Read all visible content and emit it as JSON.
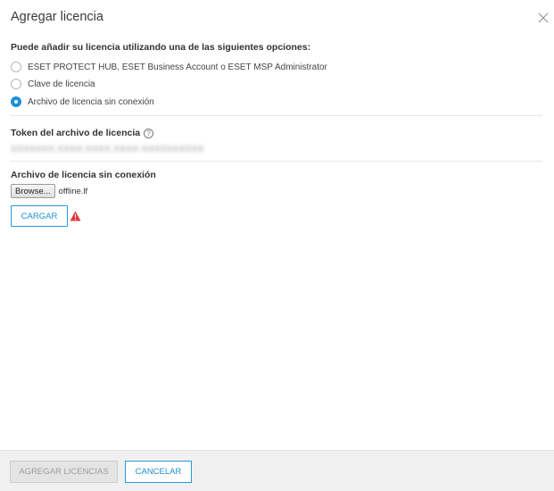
{
  "dialog": {
    "title": "Agregar licencia",
    "close_icon": "close-icon"
  },
  "options": {
    "heading": "Puede añadir su licencia utilizando una de las siguientes opciones:",
    "items": [
      {
        "label": "ESET PROTECT HUB, ESET Business Account o ESET MSP Administrator",
        "selected": false
      },
      {
        "label": "Clave de licencia",
        "selected": false
      },
      {
        "label": "Archivo de licencia sin conexión",
        "selected": true
      }
    ]
  },
  "token": {
    "label": "Token del archivo de licencia",
    "help_icon": "help-circle-icon",
    "value": "XXXXXXX-XXXX-XXXX-XXXX-XXXXXXXXXX"
  },
  "offline_file": {
    "label": "Archivo de licencia sin conexión",
    "browse_label": "Browse...",
    "file_name": "offline.lf",
    "upload_label": "CARGAR",
    "warning_icon": "warning-icon"
  },
  "footer": {
    "add_label": "AGREGAR LICENCIAS",
    "cancel_label": "CANCELAR"
  },
  "colors": {
    "accent": "#1d8fd6",
    "warning": "#e0383e",
    "footer_bg": "#f0f0f0"
  }
}
